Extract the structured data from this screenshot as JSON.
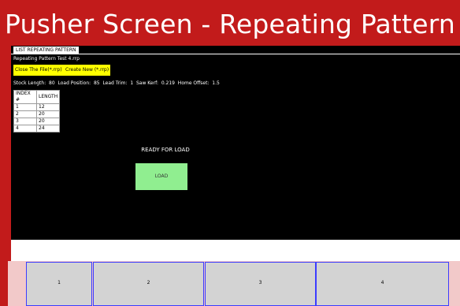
{
  "banner": {
    "title": "Pusher Screen - Repeating Pattern"
  },
  "screen": {
    "tab_label": "LIST  REPEATING PATTERN",
    "file_name": "Repeating Pattern Test 4.rrp",
    "buttons": {
      "close_file": "Close The File(*.rrp)",
      "create_new": "Create New (*.rrp)"
    },
    "params_line": "Stock Length:  80  Load Position:  85  Lead Trim:  1  Saw Kerf:  0.219  Home Offset:  1.5",
    "table": {
      "headers": [
        "INDEX #",
        "LENGTH"
      ],
      "rows": [
        [
          "1",
          "12"
        ],
        [
          "2",
          "20"
        ],
        [
          "3",
          "20"
        ],
        [
          "4",
          "24"
        ]
      ]
    },
    "status": "READY FOR LOAD",
    "load_label": "LOAD"
  },
  "bottom_buttons": [
    {
      "label": "1"
    },
    {
      "label": "2"
    },
    {
      "label": "3"
    },
    {
      "label": "4"
    }
  ],
  "colors": {
    "frame": "#c21b1b",
    "screen_bg": "#000000",
    "action_yellow": "#ffff00",
    "load_green": "#90ee90",
    "bottom_button": "#d3d3d3",
    "bottom_border": "#3c3cff"
  }
}
